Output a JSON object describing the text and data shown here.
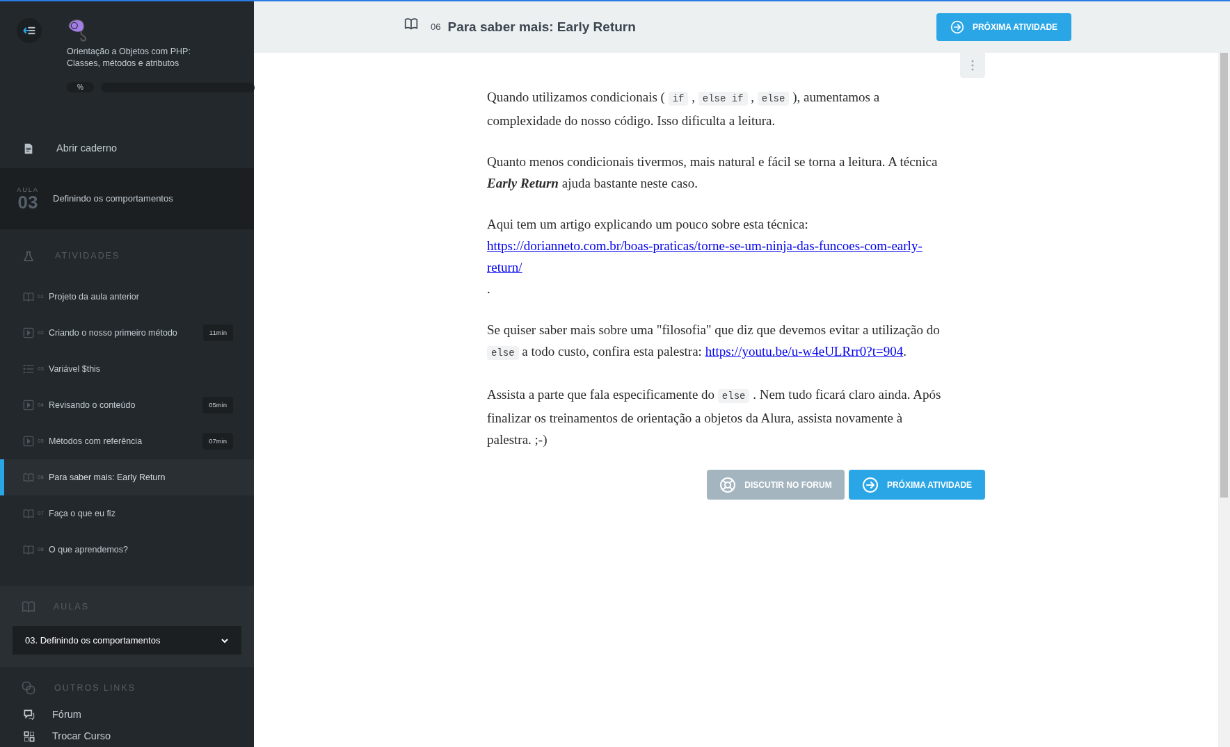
{
  "sidebar": {
    "course_title_lines": [
      "Orientação a Objetos com PHP:",
      "Classes, métodos e atributos"
    ],
    "progress": {
      "badge": "%"
    },
    "notebook_link": "Abrir caderno",
    "lesson": {
      "overline": "AULA",
      "number": "03",
      "title": "Definindo os comportamentos"
    },
    "activities_heading": "ATIVIDADES",
    "activities": [
      {
        "kind": "reading",
        "number": "01",
        "title": "Projeto da aula anterior",
        "selected": false
      },
      {
        "kind": "video",
        "number": "02",
        "title": "Criando o nosso primeiro método",
        "duration": "11min",
        "selected": false
      },
      {
        "kind": "list",
        "number": "03",
        "title": "Variável $this",
        "selected": false
      },
      {
        "kind": "video",
        "number": "04",
        "title": "Revisando o conteúdo",
        "duration": "05min",
        "selected": false
      },
      {
        "kind": "video",
        "number": "05",
        "title": "Métodos com referência",
        "duration": "07min",
        "selected": false
      },
      {
        "kind": "reading",
        "number": "06",
        "title": "Para saber mais: Early Return",
        "selected": true
      },
      {
        "kind": "reading",
        "number": "07",
        "title": "Faça o que eu fiz",
        "selected": false
      },
      {
        "kind": "reading",
        "number": "08",
        "title": "O que aprendemos?",
        "selected": false
      }
    ],
    "lessons_heading": "AULAS",
    "lesson_select": "03. Definindo os comportamentos",
    "other_links_heading": "OUTROS LINKS",
    "other_links": [
      {
        "kind": "forum",
        "label": "Fórum"
      },
      {
        "kind": "switch",
        "label": "Trocar Curso"
      }
    ]
  },
  "header": {
    "number": "06",
    "title": "Para saber mais: Early Return",
    "next_button": "PRÓXIMA ATIVIDADE"
  },
  "content": {
    "paragraphs": [
      [
        {
          "kind": "text",
          "text": "Quando utilizamos condicionais ( "
        },
        {
          "kind": "code",
          "text": "if"
        },
        {
          "kind": "text",
          "text": " , "
        },
        {
          "kind": "code",
          "text": "else if"
        },
        {
          "kind": "text",
          "text": " , "
        },
        {
          "kind": "code",
          "text": "else"
        },
        {
          "kind": "text",
          "text": " ), aumentamos a complexidade do nosso código. Isso dificulta a leitura."
        }
      ],
      [
        {
          "kind": "text",
          "text": "Quanto menos condicionais tivermos, mais natural e fácil se torna a leitura. A técnica "
        },
        {
          "kind": "emphasis",
          "text": "Early Return"
        },
        {
          "kind": "text",
          "text": " ajuda bastante neste caso."
        }
      ],
      [
        {
          "kind": "text",
          "text": "Aqui tem um artigo explicando um pouco sobre esta técnica: "
        },
        {
          "kind": "link",
          "text": "https://dorianneto.com.br/boas-praticas/torne-se-um-ninja-das-funcoes-com-early-return/"
        },
        {
          "kind": "text",
          "text": "."
        }
      ],
      [
        {
          "kind": "text",
          "text": "Se quiser saber mais sobre uma \"filosofia\" que diz que devemos evitar a utilização do "
        },
        {
          "kind": "code",
          "text": "else"
        },
        {
          "kind": "text",
          "text": " a todo custo, confira esta palestra: "
        },
        {
          "kind": "link",
          "text": "https://youtu.be/u-w4eULRrr0?t=904"
        },
        {
          "kind": "text",
          "text": "."
        }
      ],
      [
        {
          "kind": "text",
          "text": "Assista a parte que fala especificamente do "
        },
        {
          "kind": "code",
          "text": "else"
        },
        {
          "kind": "text",
          "text": " . Nem tudo ficará claro ainda. Após finalizar os treinamentos de orientação a objetos da Alura, assista novamente à palestra. ;-)"
        }
      ]
    ],
    "forum_button": "DISCUTIR NO FORUM",
    "next_button": "PRÓXIMA ATIVIDADE"
  }
}
